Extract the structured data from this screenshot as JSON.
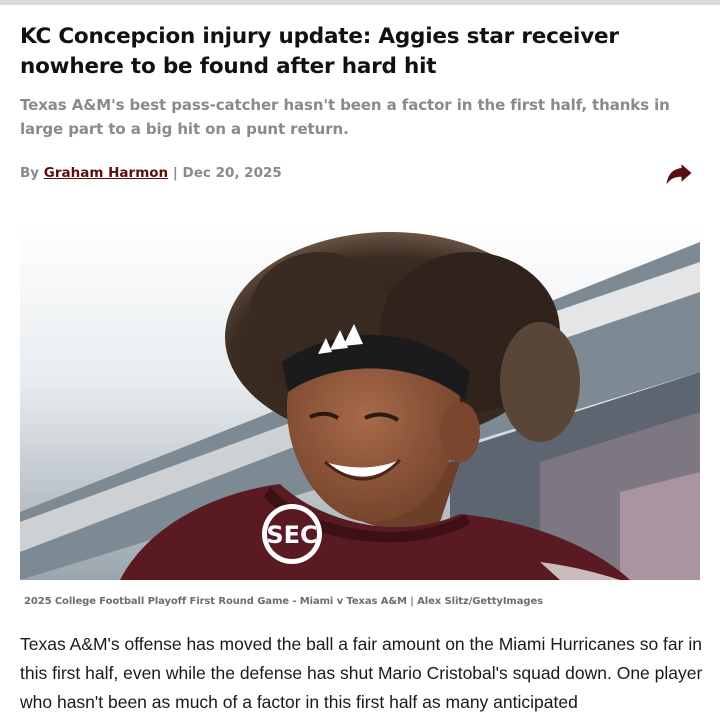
{
  "article": {
    "headline": "KC Concepcion injury update: Aggies star receiver nowhere to be found after hard hit",
    "dek": "Texas A&M's best pass-catcher hasn't been a factor in the first half, thanks in large part to a big hit on a punt return.",
    "byline_prefix": "By ",
    "author": "Graham Harmon",
    "separator": " | ",
    "date": "Dec 20, 2025",
    "share_icon": "share-arrow-icon",
    "image": {
      "caption": "2025 College Football Playoff First Round Game - Miami v Texas A&M | Alex Slitz/GettyImages",
      "jersey_patch": "SEC"
    },
    "body_paragraph": "Texas A&M's offense has moved the ball a fair amount on the Miami Hurricanes so far in this first half, even while the defense has shut Mario Cristobal's squad down. One player who hasn't been as much of a factor in this first half as many anticipated"
  },
  "colors": {
    "link": "#5b0f0f",
    "muted_text": "#8a8a8a",
    "maroon_jersey": "#5a1a22"
  }
}
